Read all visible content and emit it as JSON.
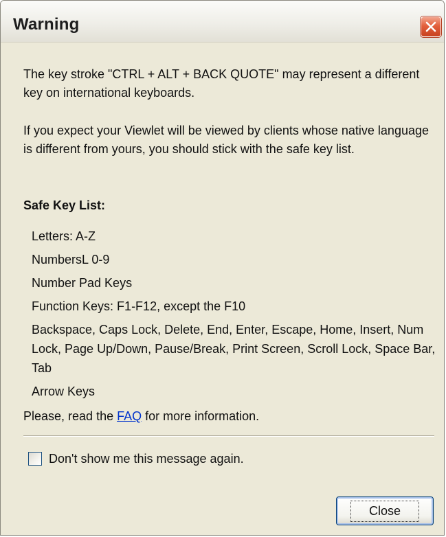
{
  "window": {
    "title": "Warning"
  },
  "icons": {
    "close": "close-x-icon"
  },
  "colors": {
    "window_bg": "#ECE9D8",
    "close_button_red": "#E3603D",
    "link": "#0033CC"
  },
  "message": {
    "paragraph1": "The key stroke \"CTRL + ALT + BACK QUOTE\" may represent a different key on international keyboards.",
    "paragraph2": "If you expect your Viewlet will be viewed by clients whose native language is different from yours, you should stick with the safe key list."
  },
  "safe_keys": {
    "heading": "Safe Key List:",
    "items": [
      "Letters: A-Z",
      "NumbersL 0-9",
      "Number Pad Keys",
      "Function Keys: F1-F12, except the F10",
      "Backspace, Caps Lock, Delete, End, Enter, Escape, Home, Insert, Num Lock, Page Up/Down, Pause/Break, Print Screen, Scroll Lock, Space Bar, Tab",
      "Arrow Keys"
    ]
  },
  "faq": {
    "prefix": "Please, read the ",
    "link_label": "FAQ",
    "suffix": " for more information."
  },
  "checkbox": {
    "label": "Don't show me this message again.",
    "checked": false
  },
  "buttons": {
    "close_label": "Close"
  }
}
